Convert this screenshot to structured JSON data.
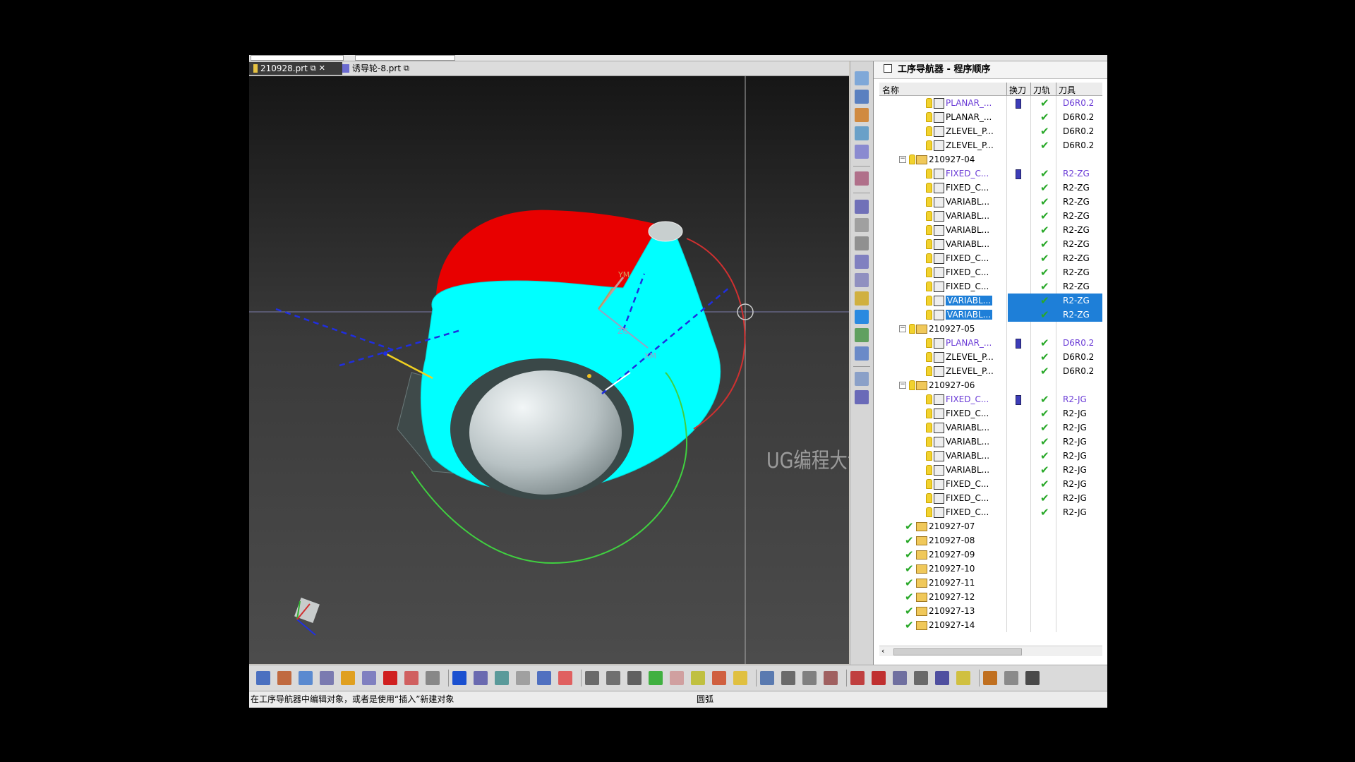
{
  "tabs": [
    {
      "label": "210928.prt",
      "active": true
    },
    {
      "label": "诱导轮-8.prt",
      "active": false
    }
  ],
  "navigator": {
    "title": "工序导航器 - 程序顺序",
    "columns": {
      "name": "名称",
      "swap": "换刀",
      "path": "刀轨",
      "tool": "刀具"
    }
  },
  "rows": [
    {
      "level": 2,
      "type": "op",
      "icon": "planar-op-icon",
      "name": "PLANAR_...",
      "swap": true,
      "tool": "D6R0.2",
      "purple": true
    },
    {
      "level": 2,
      "type": "op",
      "icon": "planar-op-icon",
      "name": "PLANAR_...",
      "swap": false,
      "tool": "D6R0.2",
      "purple": false
    },
    {
      "level": 2,
      "type": "op",
      "icon": "zlevel-op-icon",
      "name": "ZLEVEL_P...",
      "swap": false,
      "tool": "D6R0.2",
      "purple": false
    },
    {
      "level": 2,
      "type": "op",
      "icon": "zlevel-op-icon",
      "name": "ZLEVEL_P...",
      "swap": false,
      "tool": "D6R0.2",
      "purple": false
    },
    {
      "level": 1,
      "type": "group",
      "expanded": true,
      "name": "210927-04"
    },
    {
      "level": 2,
      "type": "op",
      "icon": "fixed-contour-icon",
      "name": "FIXED_C...",
      "swap": true,
      "tool": "R2-ZG",
      "purple": true
    },
    {
      "level": 2,
      "type": "op",
      "icon": "fixed-contour-icon",
      "name": "FIXED_C...",
      "swap": false,
      "tool": "R2-ZG",
      "purple": false
    },
    {
      "level": 2,
      "type": "op",
      "icon": "variable-contour-icon",
      "name": "VARIABL...",
      "swap": false,
      "tool": "R2-ZG",
      "purple": false
    },
    {
      "level": 2,
      "type": "op",
      "icon": "variable-contour-icon",
      "name": "VARIABL...",
      "swap": false,
      "tool": "R2-ZG",
      "purple": false
    },
    {
      "level": 2,
      "type": "op",
      "icon": "variable-contour-icon",
      "name": "VARIABL...",
      "swap": false,
      "tool": "R2-ZG",
      "purple": false
    },
    {
      "level": 2,
      "type": "op",
      "icon": "variable-contour-icon",
      "name": "VARIABL...",
      "swap": false,
      "tool": "R2-ZG",
      "purple": false
    },
    {
      "level": 2,
      "type": "op",
      "icon": "fixed-contour-icon",
      "name": "FIXED_C...",
      "swap": false,
      "tool": "R2-ZG",
      "purple": false
    },
    {
      "level": 2,
      "type": "op",
      "icon": "fixed-contour-icon",
      "name": "FIXED_C...",
      "swap": false,
      "tool": "R2-ZG",
      "purple": false
    },
    {
      "level": 2,
      "type": "op",
      "icon": "fixed-contour-icon",
      "name": "FIXED_C...",
      "swap": false,
      "tool": "R2-ZG",
      "purple": false
    },
    {
      "level": 2,
      "type": "op",
      "icon": "variable-contour-icon",
      "name": "VARIABL...",
      "swap": false,
      "tool": "R2-ZG",
      "purple": false,
      "selected": true
    },
    {
      "level": 2,
      "type": "op",
      "icon": "variable-contour-icon",
      "name": "VARIABL...",
      "swap": false,
      "tool": "R2-ZG",
      "purple": false,
      "selected": true
    },
    {
      "level": 1,
      "type": "group",
      "expanded": true,
      "name": "210927-05"
    },
    {
      "level": 2,
      "type": "op",
      "icon": "planar-op-icon",
      "name": "PLANAR_...",
      "swap": true,
      "tool": "D6R0.2",
      "purple": true
    },
    {
      "level": 2,
      "type": "op",
      "icon": "zlevel-op-icon",
      "name": "ZLEVEL_P...",
      "swap": false,
      "tool": "D6R0.2",
      "purple": false
    },
    {
      "level": 2,
      "type": "op",
      "icon": "zlevel-op-icon",
      "name": "ZLEVEL_P...",
      "swap": false,
      "tool": "D6R0.2",
      "purple": false
    },
    {
      "level": 1,
      "type": "group",
      "expanded": true,
      "name": "210927-06"
    },
    {
      "level": 2,
      "type": "op",
      "icon": "fixed-contour-icon",
      "name": "FIXED_C...",
      "swap": true,
      "tool": "R2-JG",
      "purple": true
    },
    {
      "level": 2,
      "type": "op",
      "icon": "fixed-contour-icon",
      "name": "FIXED_C...",
      "swap": false,
      "tool": "R2-JG",
      "purple": false
    },
    {
      "level": 2,
      "type": "op",
      "icon": "variable-contour-icon",
      "name": "VARIABL...",
      "swap": false,
      "tool": "R2-JG",
      "purple": false
    },
    {
      "level": 2,
      "type": "op",
      "icon": "variable-contour-icon",
      "name": "VARIABL...",
      "swap": false,
      "tool": "R2-JG",
      "purple": false
    },
    {
      "level": 2,
      "type": "op",
      "icon": "variable-contour-icon",
      "name": "VARIABL...",
      "swap": false,
      "tool": "R2-JG",
      "purple": false
    },
    {
      "level": 2,
      "type": "op",
      "icon": "variable-contour-icon",
      "name": "VARIABL...",
      "swap": false,
      "tool": "R2-JG",
      "purple": false
    },
    {
      "level": 2,
      "type": "op",
      "icon": "fixed-contour-icon",
      "name": "FIXED_C...",
      "swap": false,
      "tool": "R2-JG",
      "purple": false
    },
    {
      "level": 2,
      "type": "op",
      "icon": "fixed-contour-icon",
      "name": "FIXED_C...",
      "swap": false,
      "tool": "R2-JG",
      "purple": false
    },
    {
      "level": 2,
      "type": "op",
      "icon": "fixed-contour-icon",
      "name": "FIXED_C...",
      "swap": false,
      "tool": "R2-JG",
      "purple": false
    },
    {
      "level": 1,
      "type": "group",
      "expanded": false,
      "checked": true,
      "name": "210927-07"
    },
    {
      "level": 1,
      "type": "group",
      "expanded": false,
      "checked": true,
      "name": "210927-08"
    },
    {
      "level": 1,
      "type": "group",
      "expanded": false,
      "checked": true,
      "name": "210927-09"
    },
    {
      "level": 1,
      "type": "group",
      "expanded": false,
      "checked": true,
      "name": "210927-10"
    },
    {
      "level": 1,
      "type": "group",
      "expanded": false,
      "checked": true,
      "name": "210927-11"
    },
    {
      "level": 1,
      "type": "group",
      "expanded": false,
      "checked": true,
      "name": "210927-12"
    },
    {
      "level": 1,
      "type": "group",
      "expanded": false,
      "checked": true,
      "name": "210927-13"
    },
    {
      "level": 1,
      "type": "group",
      "expanded": false,
      "checked": true,
      "name": "210927-14"
    }
  ],
  "viewport": {
    "axis_labels": {
      "ym": "YM",
      "zc": "ZC",
      "xm": "XM"
    },
    "watermark": "UG编程大课堂-莫莫"
  },
  "status": {
    "message": "在工序导航器中编辑对象，或者是使用“插入”新建对象",
    "right": "圆弧"
  },
  "colors": {
    "cyan_part": "#00ffff",
    "red_face": "#e80000",
    "selection": "#1e7fd8",
    "check_green": "#28a828",
    "swap_purple": "#6a3bd6"
  }
}
